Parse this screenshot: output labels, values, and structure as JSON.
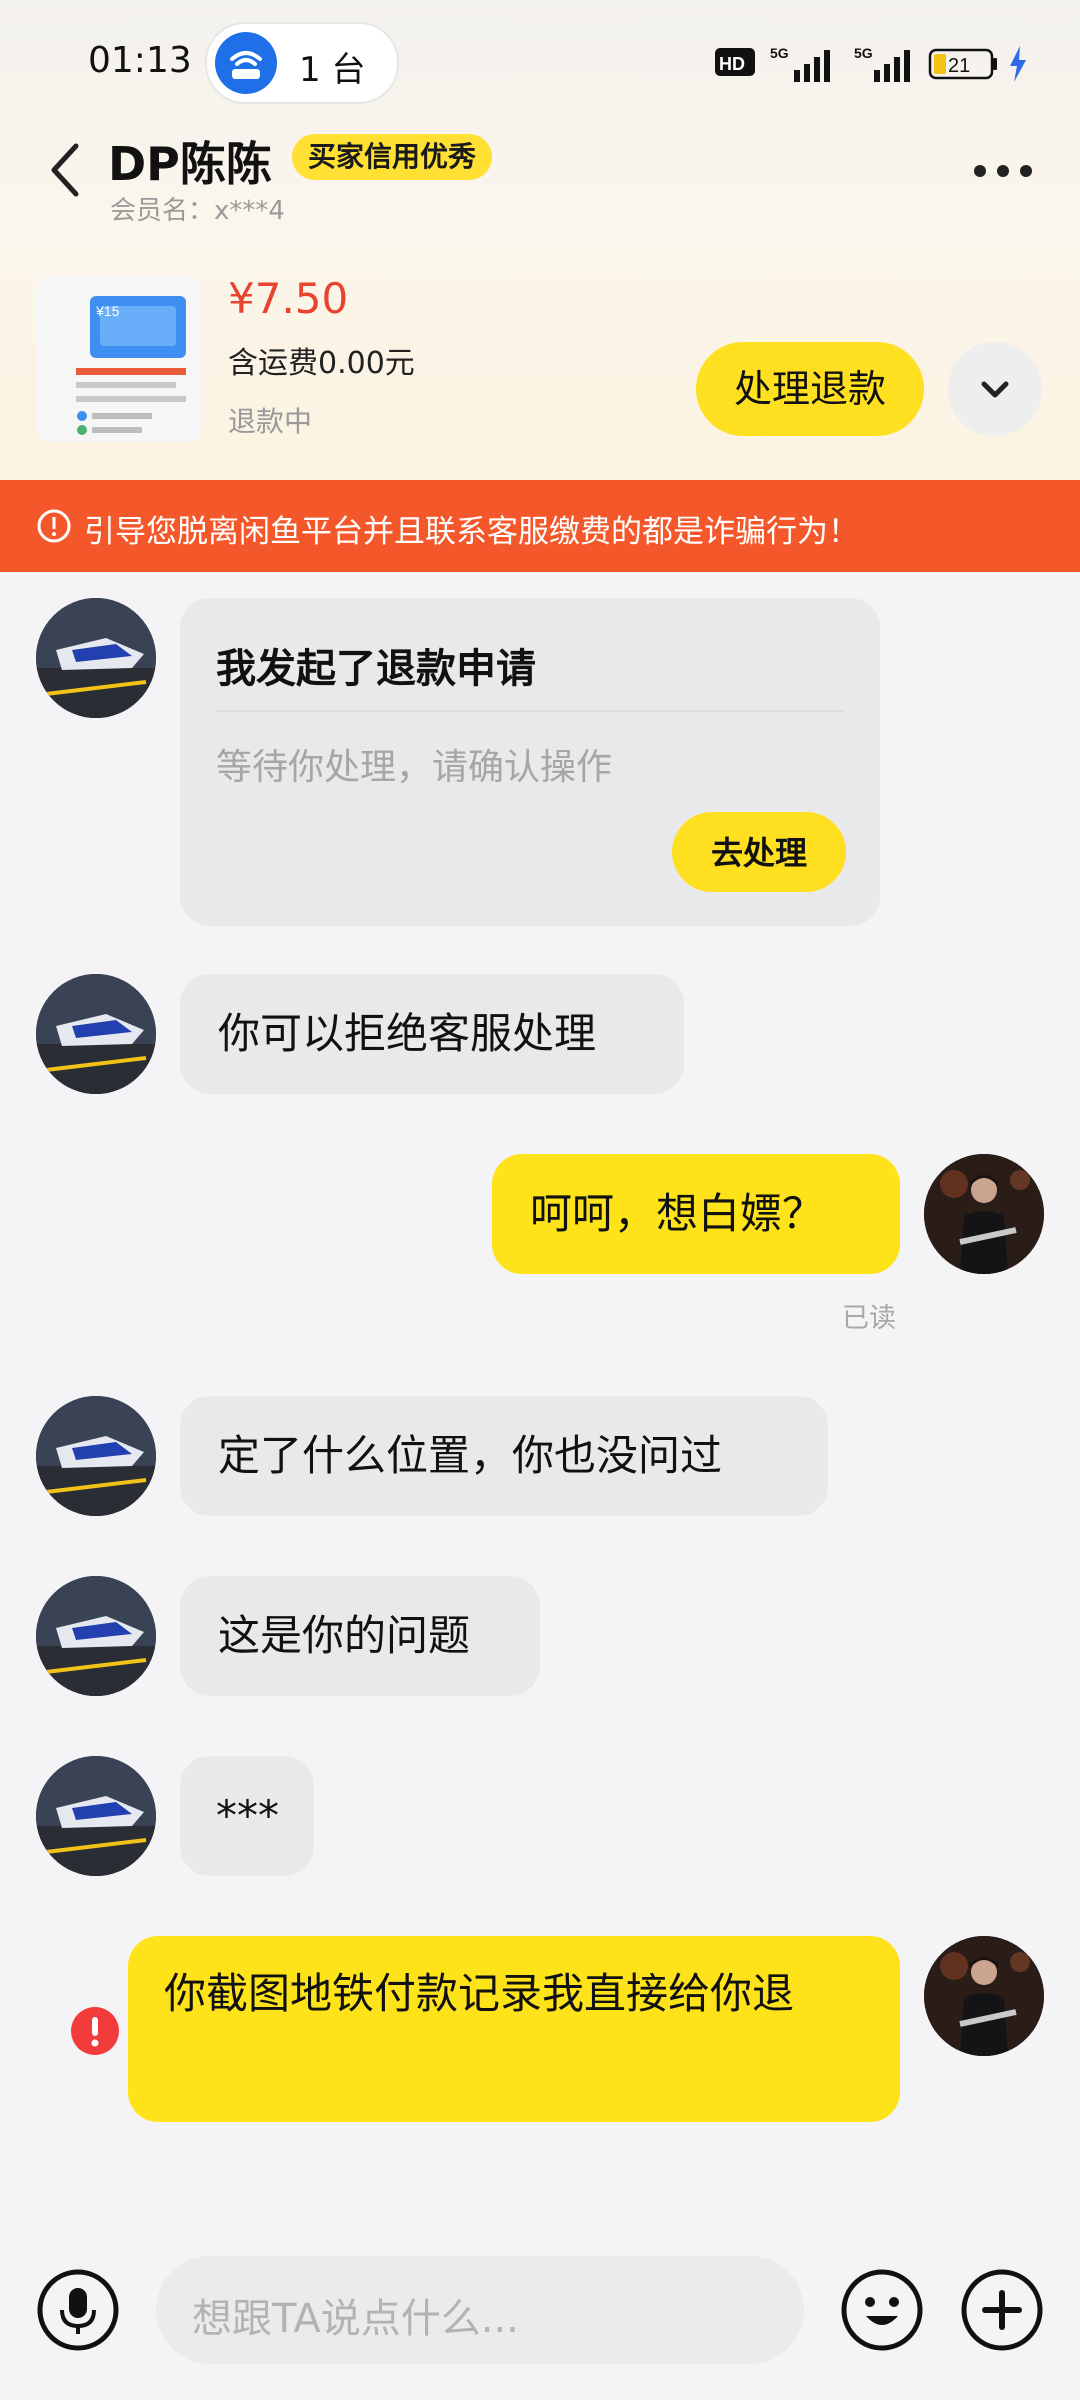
{
  "status_bar": {
    "time": "01:13",
    "hotspot_count": "1 台",
    "battery": "21",
    "hd_label": "HD",
    "net1": "5G",
    "net2": "5G"
  },
  "header": {
    "seller_name": "DP陈陈",
    "credit_badge": "买家信用优秀",
    "member_name": "会员名：x***4"
  },
  "product": {
    "price": "¥7.50",
    "shipping": "含运费0.00元",
    "status": "退款中",
    "thumb_label": "¥15",
    "refund_button": "处理退款"
  },
  "warning": {
    "text": "引导您脱离闲鱼平台并且联系客服缴费的都是诈骗行为！"
  },
  "messages": {
    "refund_card": {
      "title": "我发起了退款申请",
      "subtitle": "等待你处理，请确认操作",
      "button": "去处理"
    },
    "m1": "你可以拒绝客服处理",
    "m2": "呵呵，想白嫖？",
    "m2_read": "已读",
    "m3": "定了什么位置，你也没问过",
    "m4": "这是你的问题",
    "m5": "***",
    "m6": "你截图地铁付款记录我直接给你退"
  },
  "input": {
    "placeholder": "想跟TA说点什么..."
  },
  "colors": {
    "accent_yellow": "#ffe31a",
    "warning_orange": "#f4582a",
    "price_red": "#e8432f"
  }
}
